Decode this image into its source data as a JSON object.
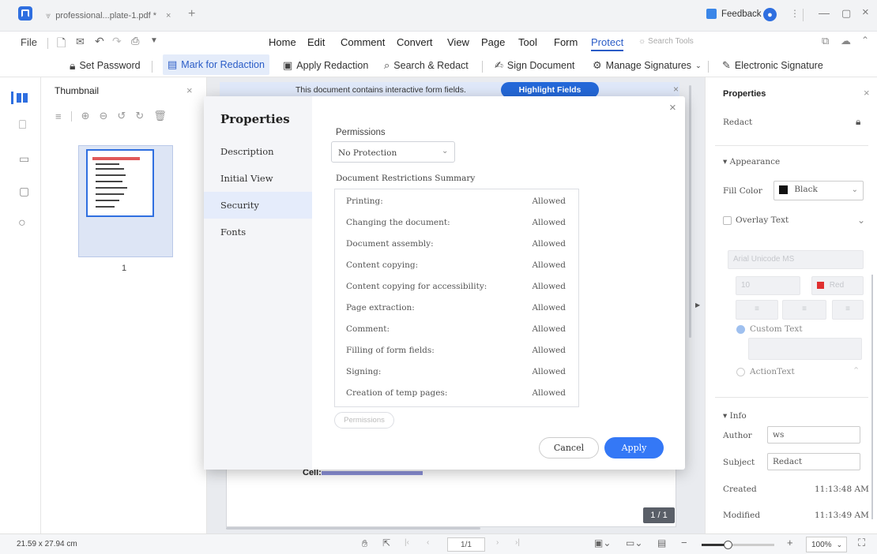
{
  "titlebar": {
    "tab_title": "professional...plate-1.pdf *",
    "tab_close": "×",
    "new_tab": "+",
    "feedback": "Feedback"
  },
  "menu": {
    "file": "File",
    "items": [
      "Home",
      "Edit",
      "Comment",
      "Convert",
      "View",
      "Page",
      "Tool",
      "Form",
      "Protect"
    ],
    "search_tools": "Search Tools"
  },
  "toolbar": {
    "set_password": "Set Password",
    "mark_for_redaction": "Mark for Redaction",
    "apply_redaction": "Apply Redaction",
    "search_redact": "Search & Redact",
    "sign_document": "Sign Document",
    "manage_signatures": "Manage Signatures",
    "electronic_signature": "Electronic Signature"
  },
  "thumbnail_panel": {
    "title": "Thumbnail",
    "page_number": "1"
  },
  "notice": {
    "text": "This document contains interactive form fields.",
    "button": "Highlight Fields"
  },
  "doc": {
    "cell_label": "Cell:",
    "page_badge": "1 / 1"
  },
  "dialog": {
    "title": "Properties",
    "tabs": [
      "Description",
      "Initial View",
      "Security",
      "Fonts"
    ],
    "active_tab": "Security",
    "permissions_label": "Permissions",
    "permissions_value": "No Protection",
    "summary_title": "Document Restrictions Summary",
    "restrictions": [
      {
        "name": "Printing:",
        "status": "Allowed"
      },
      {
        "name": "Changing the document:",
        "status": "Allowed"
      },
      {
        "name": "Document assembly:",
        "status": "Allowed"
      },
      {
        "name": "Content copying:",
        "status": "Allowed"
      },
      {
        "name": "Content copying for accessibility:",
        "status": "Allowed"
      },
      {
        "name": "Page extraction:",
        "status": "Allowed"
      },
      {
        "name": "Comment:",
        "status": "Allowed"
      },
      {
        "name": "Filling of form fields:",
        "status": "Allowed"
      },
      {
        "name": "Signing:",
        "status": "Allowed"
      },
      {
        "name": "Creation of temp pages:",
        "status": "Allowed"
      }
    ],
    "permissions_button": "Permissions",
    "cancel": "Cancel",
    "apply": "Apply"
  },
  "properties_panel": {
    "title": "Properties",
    "redact_label": "Redact",
    "appearance": "Appearance",
    "fill_color_label": "Fill Color",
    "fill_color_value": "Black",
    "overlay_text": "Overlay Text",
    "font_name": "Arial Unicode MS",
    "font_size": "10",
    "font_color": "Red",
    "custom_text": "Custom Text",
    "action_text": "ActionText",
    "info": "Info",
    "author_label": "Author",
    "author_value": "ws",
    "subject_label": "Subject",
    "subject_value": "Redact",
    "created_label": "Created",
    "created_value": "11:13:48 AM",
    "modified_label": "Modified",
    "modified_value": "11:13:49 AM"
  },
  "statusbar": {
    "page_size": "21.59 x 27.94 cm",
    "page_field": "1/1",
    "zoom": "100%",
    "zoom_level": 0.15
  },
  "colors": {
    "accent": "#2f6fe0",
    "protect_blue": "#2a5cc7",
    "apply_button": "#3478f6",
    "highlight_badge": "#2468d8"
  }
}
